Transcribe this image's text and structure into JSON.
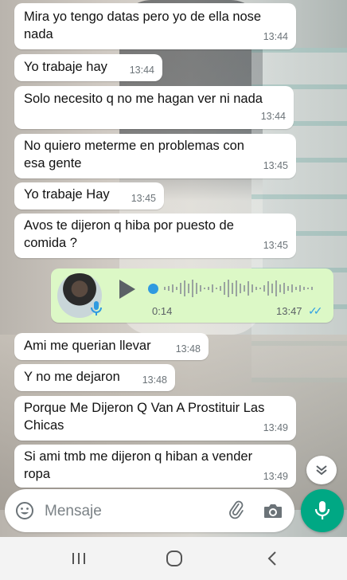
{
  "messages": [
    {
      "text": "Mira yo tengo datas pero yo de ella nose\nnada",
      "time": "13:44"
    },
    {
      "text": "Yo trabaje hay",
      "time": "13:44"
    },
    {
      "text": "Solo necesito q no me hagan ver ni nada",
      "time": "13:44"
    },
    {
      "text": "No quiero meterme en problemas con\nesa gente",
      "time": "13:45"
    },
    {
      "text": "Yo trabaje Hay",
      "time": "13:45"
    },
    {
      "text": "Avos te dijeron q hiba por puesto de\ncomida ?",
      "time": "13:45"
    },
    {
      "text": "Ami me querian llevar",
      "time": "13:48"
    },
    {
      "text": "Y no me dejaron",
      "time": "13:48"
    },
    {
      "text": "Porque Me Dijeron Q Van A Prostituir Las\nChicas",
      "time": "13:49"
    },
    {
      "text": "Si ami tmb me dijeron q hiban a vender\nropa",
      "time": "13:49"
    }
  ],
  "voice_note": {
    "duration": "0:14",
    "time": "13:47",
    "status_icon": "double-check-blue",
    "progress": 0
  },
  "composer": {
    "placeholder": "Mensaje"
  },
  "icons": {
    "emoji": "emoji-icon",
    "attach": "paperclip-icon",
    "camera": "camera-icon",
    "mic": "mic-icon",
    "scroll": "chevron-double-down-icon"
  },
  "colors": {
    "incoming_bubble": "#ffffff",
    "outgoing_bubble": "#dcf8c6",
    "accent": "#00a884",
    "read_ticks": "#33a2e3"
  }
}
